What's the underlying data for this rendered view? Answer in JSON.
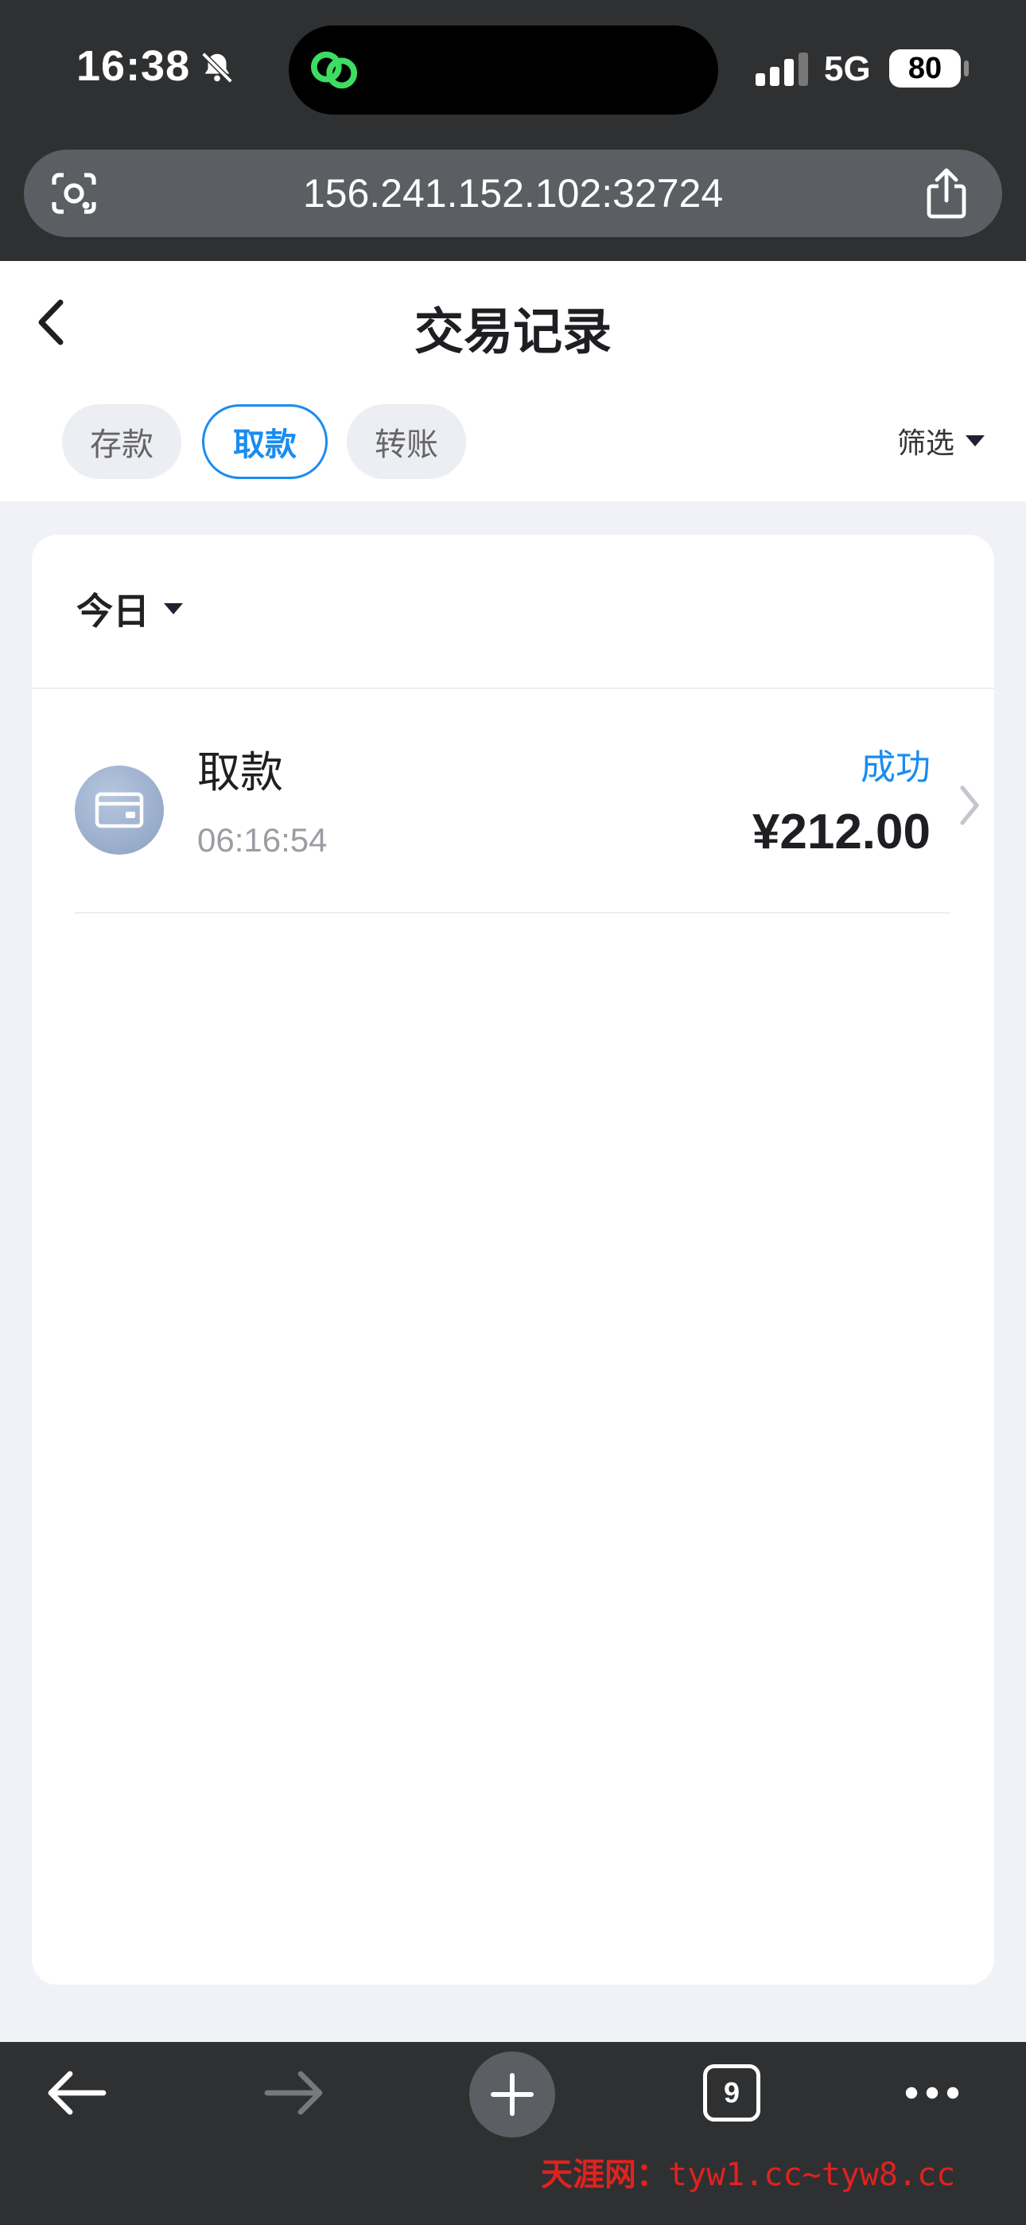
{
  "status_bar": {
    "time": "16:38",
    "network": "5G",
    "battery": "80"
  },
  "browser": {
    "url": "156.241.152.102:32724",
    "tabs_count": "9"
  },
  "header": {
    "title": "交易记录"
  },
  "tabs": [
    {
      "label": "存款",
      "active": false
    },
    {
      "label": "取款",
      "active": true
    },
    {
      "label": "转账",
      "active": false
    }
  ],
  "filter": {
    "label": "筛选"
  },
  "date_filter": {
    "label": "今日"
  },
  "records": [
    {
      "title": "取款",
      "time": "06:16:54",
      "status": "成功",
      "amount": "¥212.00"
    }
  ],
  "watermark": {
    "name": "天涯网：",
    "domains": "tyw1.cc~tyw8.cc"
  },
  "colors": {
    "accent": "#1a8cf0",
    "chrome": "#2f3032",
    "background": "#f1f2f7"
  }
}
